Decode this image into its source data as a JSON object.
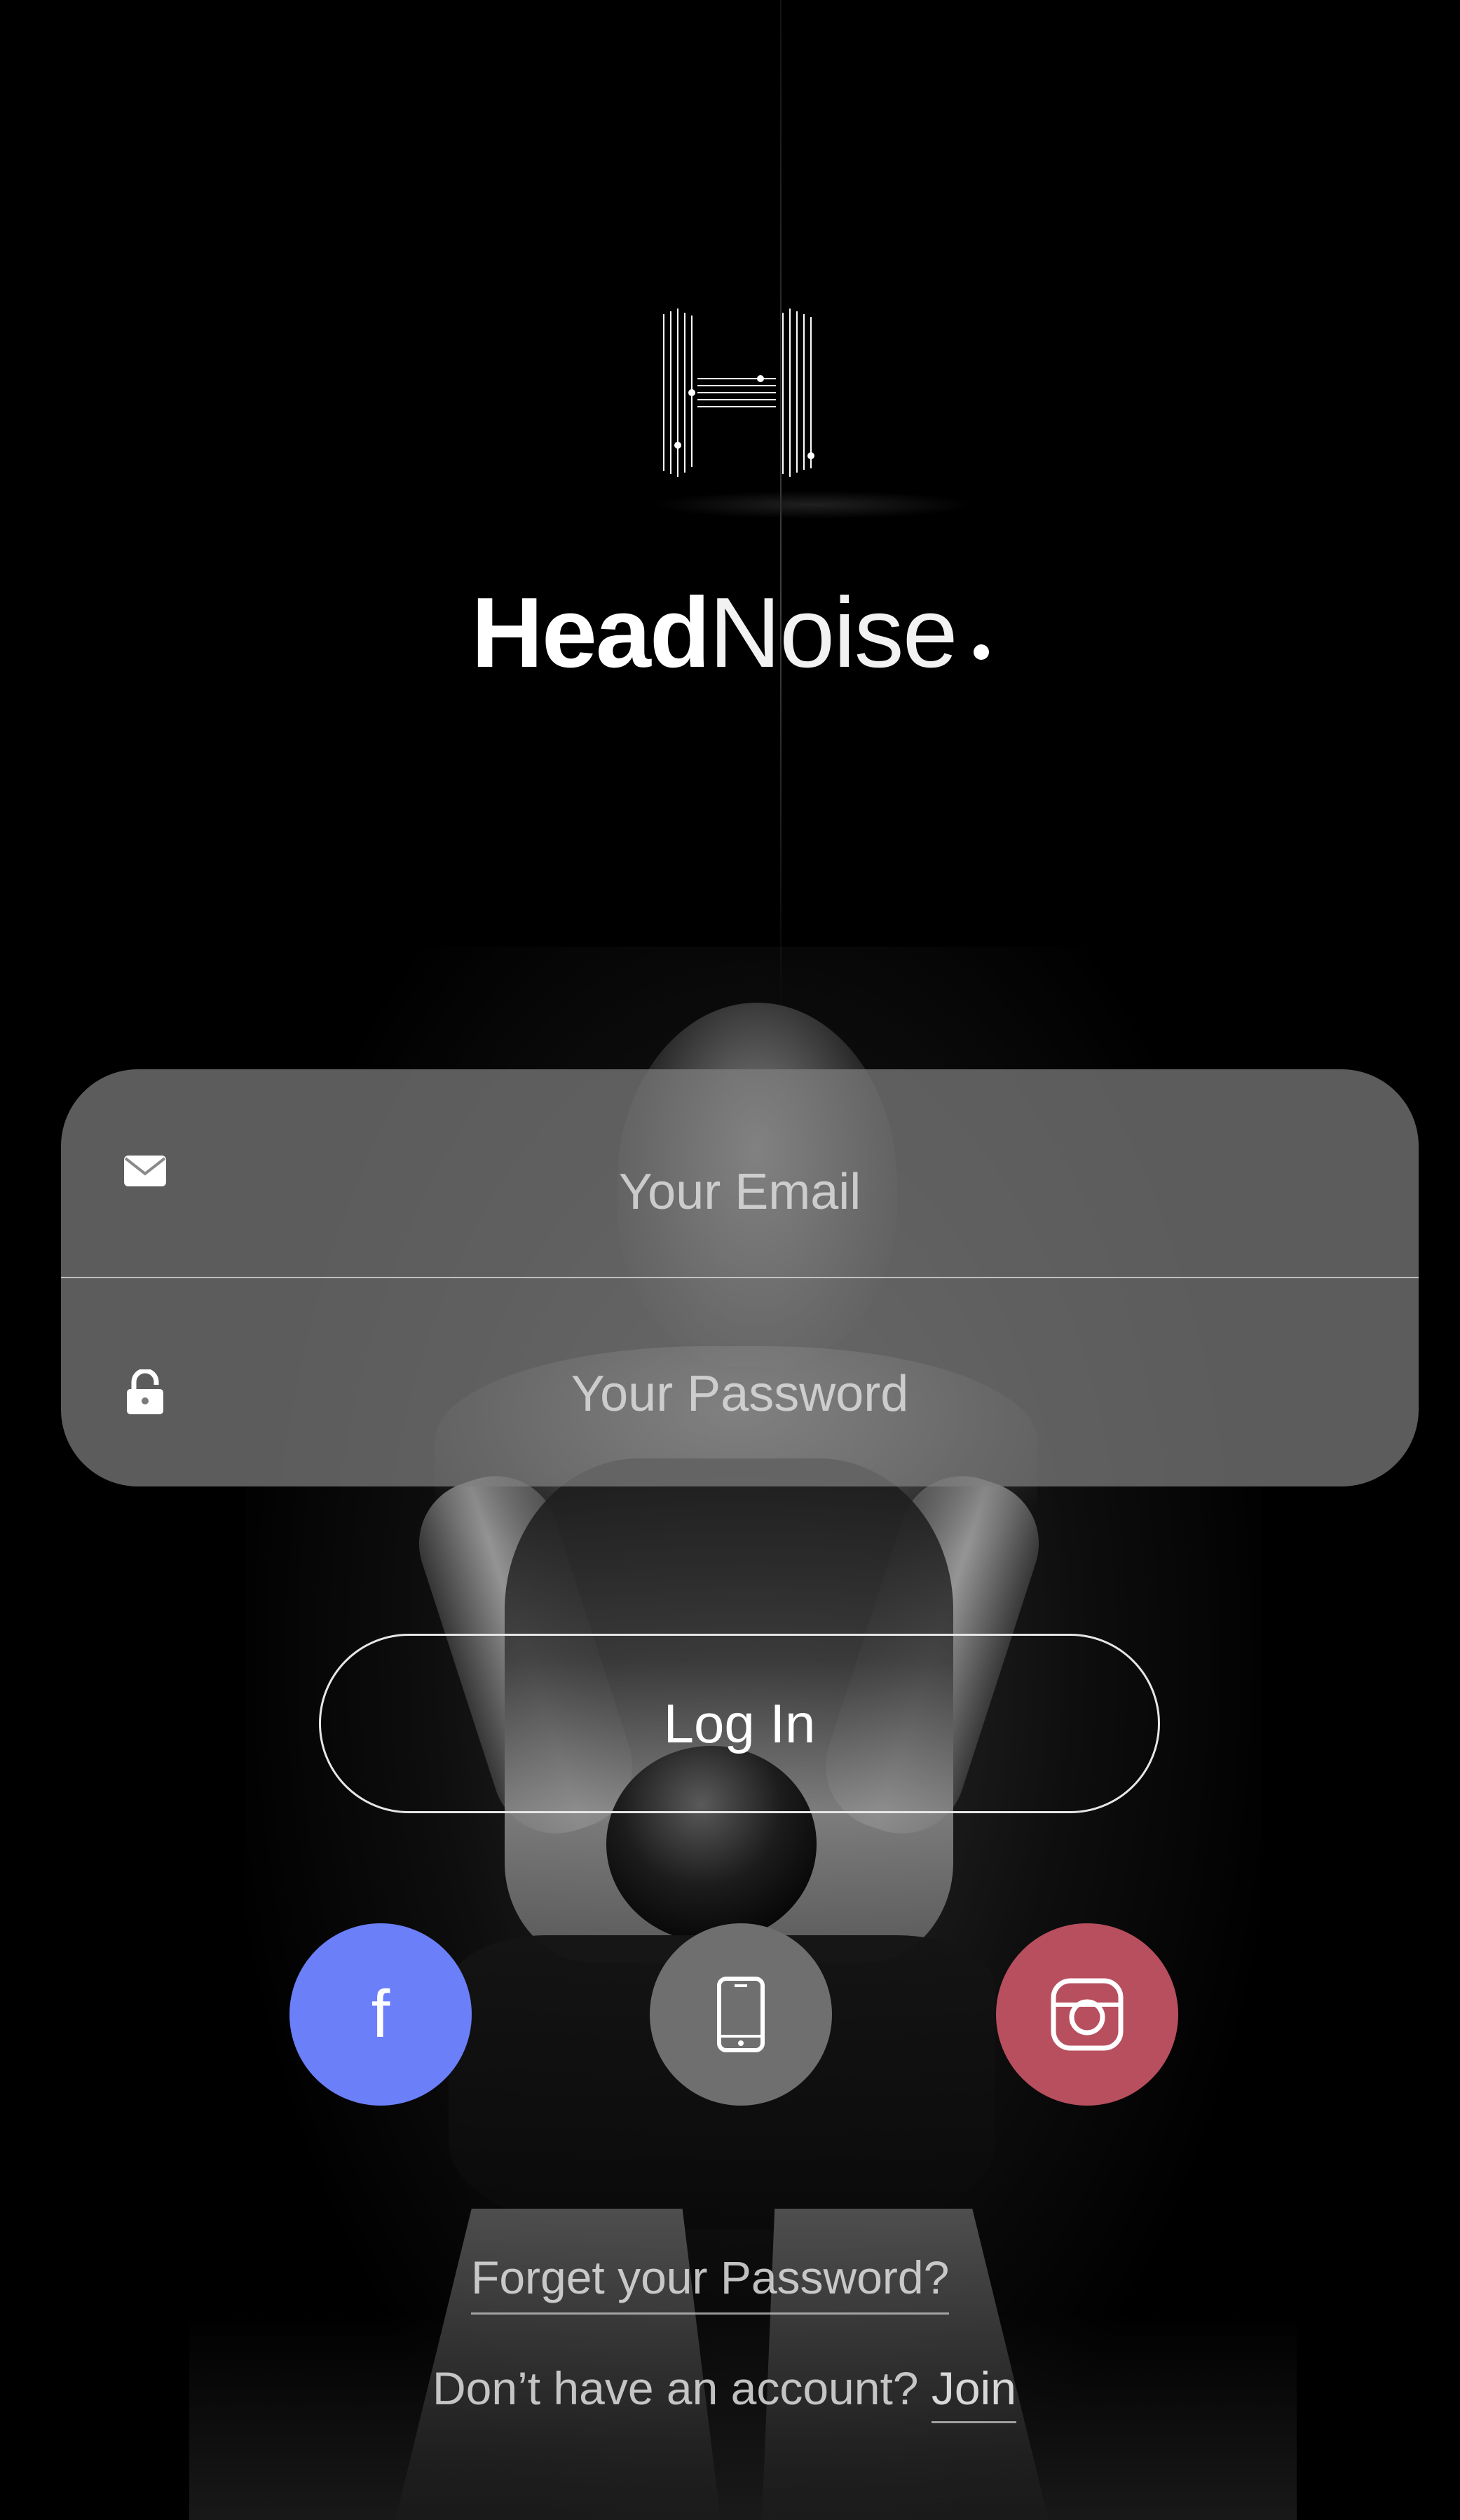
{
  "brand": {
    "name_bold": "Head",
    "name_light": "Noise",
    "logo_icon": "H-lines-logo"
  },
  "login_form": {
    "email_placeholder": "Your Email",
    "email_icon": "envelope-icon",
    "password_placeholder": "Your Password",
    "password_icon": "lock-icon"
  },
  "login_button_label": "Log In",
  "social": [
    {
      "name": "facebook",
      "icon": "facebook-icon",
      "label": "f",
      "color": "#6b7ff9"
    },
    {
      "name": "phone",
      "icon": "phone-icon",
      "color": "#6f6f6f"
    },
    {
      "name": "instagram",
      "icon": "instagram-icon",
      "color": "#b84f5e"
    }
  ],
  "links": {
    "forgot_password": "Forget your Password?",
    "no_account": "Don’t have an account?",
    "join": "Join"
  }
}
